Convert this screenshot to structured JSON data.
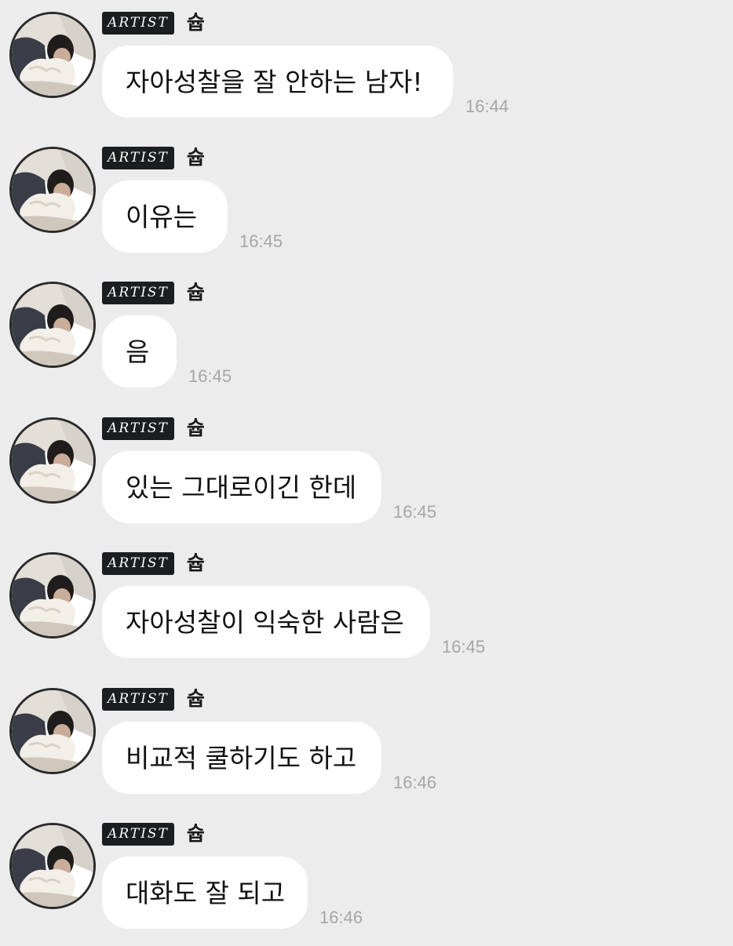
{
  "chat": {
    "messages": [
      {
        "badge": "ARTIST",
        "sender": "슙",
        "text": "자아성찰을 잘 안하는 남자!",
        "time": "16:44"
      },
      {
        "badge": "ARTIST",
        "sender": "슙",
        "text": "이유는",
        "time": "16:45"
      },
      {
        "badge": "ARTIST",
        "sender": "슙",
        "text": "음",
        "time": "16:45"
      },
      {
        "badge": "ARTIST",
        "sender": "슙",
        "text": "있는 그대로이긴 한데",
        "time": "16:45"
      },
      {
        "badge": "ARTIST",
        "sender": "슙",
        "text": "자아성찰이 익숙한 사람은",
        "time": "16:45"
      },
      {
        "badge": "ARTIST",
        "sender": "슙",
        "text": "비교적 쿨하기도 하고",
        "time": "16:46"
      },
      {
        "badge": "ARTIST",
        "sender": "슙",
        "text": "대화도 잘 되고",
        "time": "16:46"
      }
    ]
  },
  "avatar_icon": "profile-photo-person-with-plush"
}
